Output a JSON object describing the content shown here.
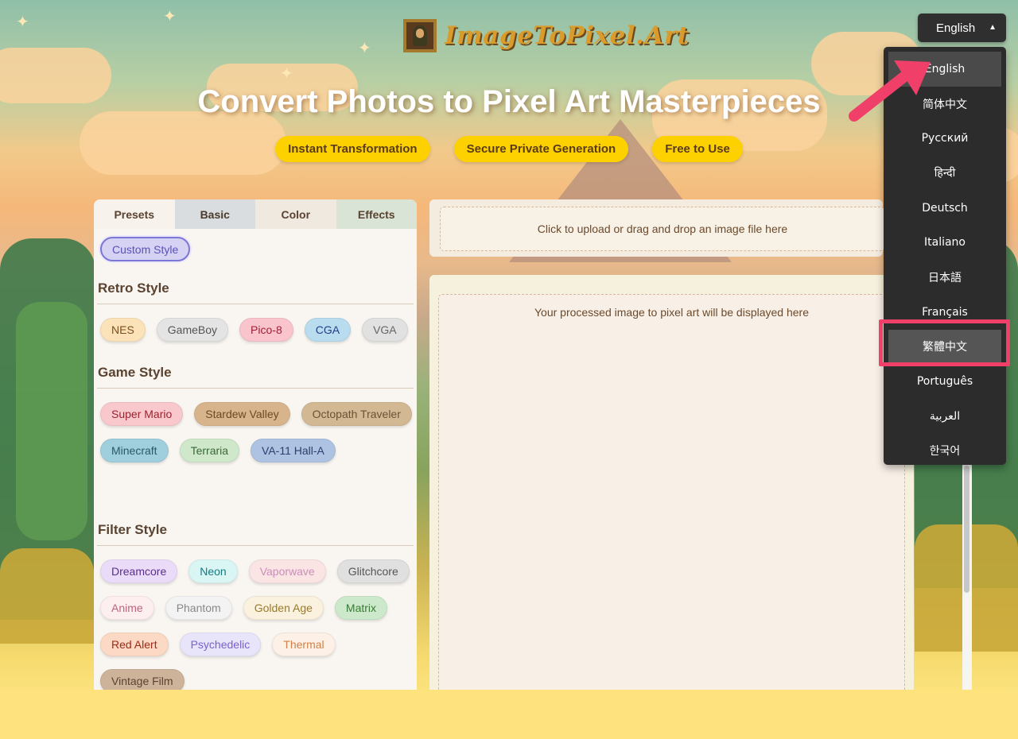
{
  "brand": {
    "logo_text": "ImageToPixel.Art"
  },
  "hero": {
    "title": "Convert Photos to Pixel Art Masterpieces",
    "badges": [
      "Instant Transformation",
      "Secure Private Generation",
      "Free to Use"
    ]
  },
  "language": {
    "current": "English",
    "options": [
      "English",
      "简体中文",
      "Русский",
      "हिन्दी",
      "Deutsch",
      "Italiano",
      "日本語",
      "Français",
      "繁體中文",
      "Português",
      "العربية",
      "한국어"
    ],
    "highlighted": "繁體中文"
  },
  "left_panel": {
    "tabs": [
      "Presets",
      "Basic",
      "Color",
      "Effects"
    ],
    "active_tab": "Presets",
    "custom_style_label": "Custom Style",
    "sections": [
      {
        "title": "Retro Style",
        "chips": [
          "NES",
          "GameBoy",
          "Pico-8",
          "CGA",
          "VGA"
        ]
      },
      {
        "title": "Game Style",
        "chips": [
          "Super Mario",
          "Stardew Valley",
          "Octopath Traveler",
          "Minecraft",
          "Terraria",
          "VA-11 Hall-A"
        ]
      },
      {
        "title": "Filter Style",
        "chips": [
          "Dreamcore",
          "Neon",
          "Vaporwave",
          "Glitchcore",
          "Anime",
          "Phantom",
          "Golden Age",
          "Matrix",
          "Red Alert",
          "Psychedelic",
          "Thermal",
          "Vintage Film"
        ]
      }
    ]
  },
  "upload": {
    "placeholder": "Click to upload or drag and drop an image file here"
  },
  "output": {
    "placeholder": "Your processed image to pixel art will be displayed here"
  },
  "colors": {
    "badge_bg": "#fdd100",
    "menu_bg": "#2c2c2c",
    "highlight_border": "#f0406a",
    "arrow": "#f0406a"
  }
}
